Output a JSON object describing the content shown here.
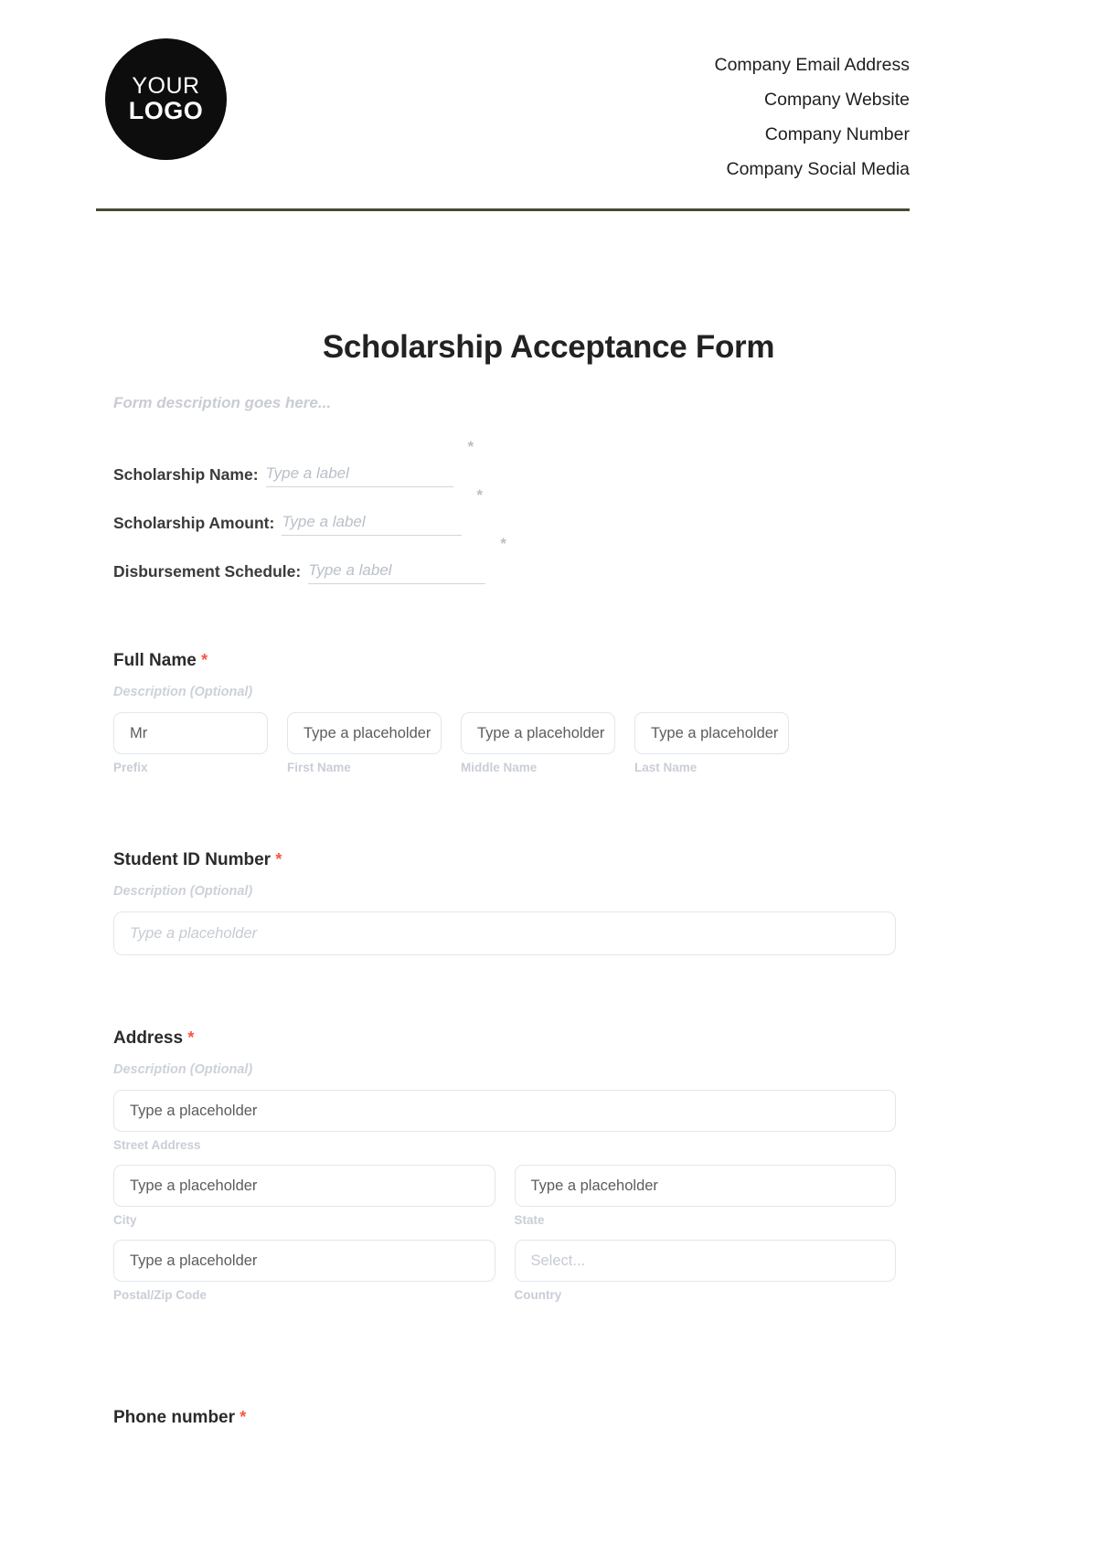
{
  "header": {
    "logo": {
      "line1": "YOUR",
      "line2": "LOGO"
    },
    "contact": [
      "Company Email Address",
      "Company Website",
      "Company Number",
      "Company Social Media"
    ]
  },
  "form": {
    "title": "Scholarship Acceptance Form",
    "description": "Form description goes here...",
    "required_marker": "*",
    "inline_fields": [
      {
        "label": "Scholarship Name:",
        "placeholder": "Type a label",
        "required": true
      },
      {
        "label": "Scholarship Amount:",
        "placeholder": "Type a label",
        "required": true
      },
      {
        "label": "Disbursement Schedule:",
        "placeholder": "Type a label",
        "required": true
      }
    ],
    "sections": [
      {
        "title": "Full Name",
        "required": true,
        "description": "Description (Optional)",
        "fields": [
          {
            "value": "Mr",
            "sublabel": "Prefix",
            "muted": false
          },
          {
            "value": "Type a placeholder",
            "sublabel": "First Name",
            "muted": false
          },
          {
            "value": "Type a placeholder",
            "sublabel": "Middle Name",
            "muted": false
          },
          {
            "value": "Type a placeholder",
            "sublabel": "Last Name",
            "muted": false
          }
        ]
      },
      {
        "title": "Student ID Number",
        "required": true,
        "description": "Description (Optional)",
        "fields": [
          {
            "value": "Type a placeholder",
            "sublabel": "",
            "muted": true
          }
        ]
      },
      {
        "title": "Address",
        "required": true,
        "description": "Description (Optional)",
        "fields": [
          {
            "value": "Type a placeholder",
            "sublabel": "Street Address",
            "muted": false
          },
          {
            "value": "Type a placeholder",
            "sublabel": "City",
            "muted": false
          },
          {
            "value": "Type a placeholder",
            "sublabel": "State",
            "muted": false
          },
          {
            "value": "Type a placeholder",
            "sublabel": "Postal/Zip Code",
            "muted": false
          },
          {
            "value": "Select...",
            "sublabel": "Country",
            "muted": true
          }
        ]
      },
      {
        "title": "Phone number",
        "required": true,
        "description": "",
        "fields": []
      }
    ]
  },
  "colors": {
    "required_star": "#fa5442",
    "rule": "#4a4a33",
    "logo_background": "#0d0d0d",
    "field_border": "#e2e6eb",
    "muted_text": "#c9ced6"
  }
}
